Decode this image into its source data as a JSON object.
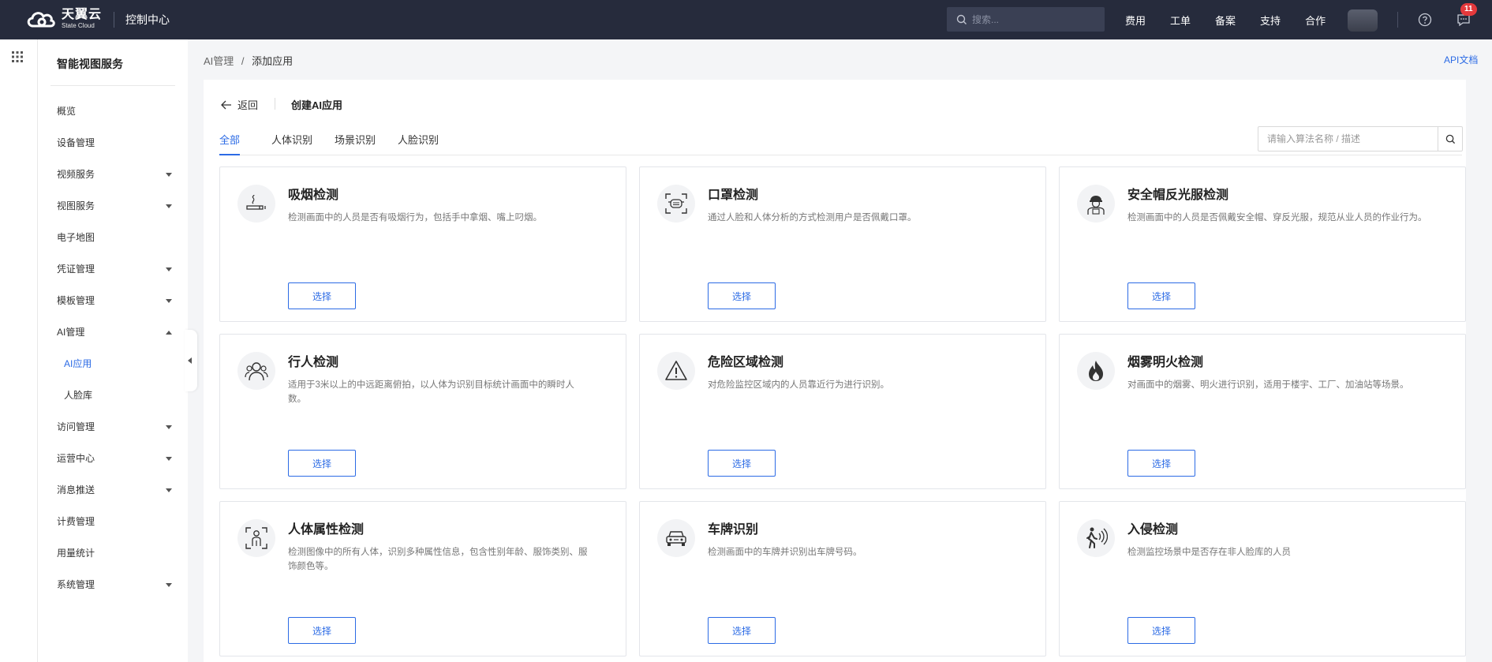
{
  "header": {
    "logo_cn": "天翼云",
    "logo_en": "State Cloud",
    "console": "控制中心",
    "search_placeholder": "搜索...",
    "nav": [
      "费用",
      "工单",
      "备案",
      "支持",
      "合作"
    ],
    "badge_count": "11"
  },
  "sidebar": {
    "title": "智能视图服务",
    "items": [
      {
        "label": "概览",
        "arrow": ""
      },
      {
        "label": "设备管理",
        "arrow": ""
      },
      {
        "label": "视频服务",
        "arrow": "down"
      },
      {
        "label": "视图服务",
        "arrow": "down"
      },
      {
        "label": "电子地图",
        "arrow": ""
      },
      {
        "label": "凭证管理",
        "arrow": "down"
      },
      {
        "label": "模板管理",
        "arrow": "down"
      },
      {
        "label": "AI管理",
        "arrow": "up"
      }
    ],
    "sub_items": [
      {
        "label": "AI应用",
        "active": true
      },
      {
        "label": "人脸库",
        "active": false
      }
    ],
    "items_after": [
      {
        "label": "访问管理",
        "arrow": "down"
      },
      {
        "label": "运营中心",
        "arrow": "down"
      },
      {
        "label": "消息推送",
        "arrow": "down"
      },
      {
        "label": "计费管理",
        "arrow": ""
      },
      {
        "label": "用量统计",
        "arrow": ""
      },
      {
        "label": "系统管理",
        "arrow": "down"
      }
    ]
  },
  "breadcrumb": {
    "parent": "AI管理",
    "separator": "/",
    "current": "添加应用"
  },
  "api_doc": "API文档",
  "panel": {
    "back_label": "返回",
    "title": "创建AI应用",
    "tabs": [
      "全部",
      "人体识别",
      "场景识别",
      "人脸识别"
    ],
    "search_placeholder": "请输入算法名称 / 描述",
    "select_label": "选择"
  },
  "cards": [
    {
      "name": "吸烟检测",
      "desc": "检测画面中的人员是否有吸烟行为，包括手中拿烟、嘴上叼烟。",
      "icon": "smoking-icon"
    },
    {
      "name": "口罩检测",
      "desc": "通过人脸和人体分析的方式检测用户是否佩戴口罩。",
      "icon": "mask-icon"
    },
    {
      "name": "安全帽反光服检测",
      "desc": "检测画面中的人员是否佩戴安全帽、穿反光服，规范从业人员的作业行为。",
      "icon": "helmet-worker-icon"
    },
    {
      "name": "行人检测",
      "desc": "适用于3米以上的中远距离俯拍，以人体为识别目标统计画面中的瞬时人数。",
      "icon": "pedestrian-icon"
    },
    {
      "name": "危险区域检测",
      "desc": "对危险监控区域内的人员靠近行为进行识别。",
      "icon": "warning-triangle-icon"
    },
    {
      "name": "烟雾明火检测",
      "desc": "对画面中的烟雾、明火进行识别，适用于楼宇、工厂、加油站等场景。",
      "icon": "fire-icon"
    },
    {
      "name": "人体属性检测",
      "desc": "检测图像中的所有人体，识别多种属性信息，包含性别年龄、服饰类别、服饰颜色等。",
      "icon": "person-frame-icon"
    },
    {
      "name": "车牌识别",
      "desc": "检测画面中的车牌并识别出车牌号码。",
      "icon": "car-icon"
    },
    {
      "name": "入侵检测",
      "desc": "检测监控场景中是否存在非人脸库的人员",
      "icon": "intrusion-icon"
    }
  ]
}
